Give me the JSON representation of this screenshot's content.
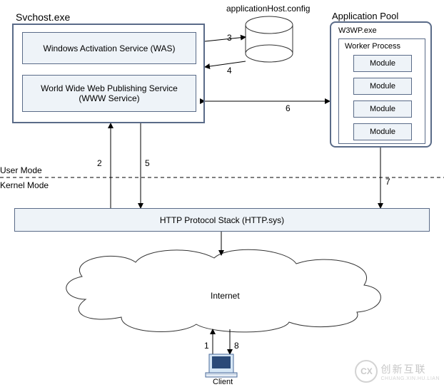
{
  "svchost": {
    "title": "Svchost.exe",
    "was": "Windows Activation Service (WAS)",
    "www": "World Wide Web Publishing Service\n(WWW Service)"
  },
  "appHostConfig": "applicationHost.config",
  "appPool": {
    "title": "Application Pool",
    "w3wp": "W3WP.exe",
    "workerProcess": "Worker Process",
    "module": "Module"
  },
  "userMode": "User Mode",
  "kernelMode": "Kernel Mode",
  "httpsys": "HTTP Protocol Stack (HTTP.sys)",
  "internet": "Internet",
  "client": "Client",
  "steps": {
    "1": "1",
    "2": "2",
    "3": "3",
    "4": "4",
    "5": "5",
    "6": "6",
    "7": "7",
    "8": "8"
  },
  "watermark": {
    "brand": "CX",
    "zh": "创新互联",
    "py": "CHUANG.XIN.HU.LIAN"
  }
}
